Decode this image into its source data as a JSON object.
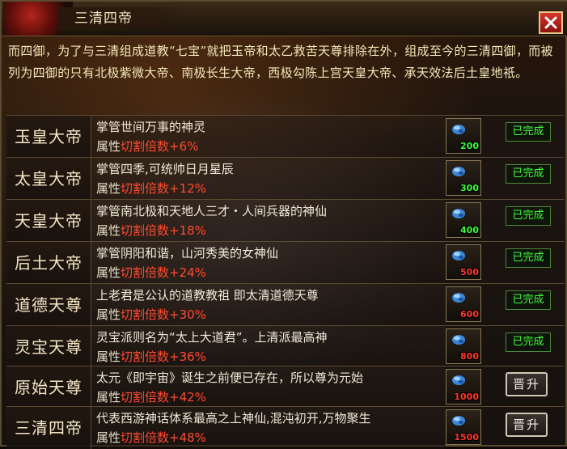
{
  "window": {
    "title": "三清四帝"
  },
  "description": "而四御，为了与三清组成道教“七宝”就把玉帝和太乙救苦天尊排除在外，组成至今的三清四御，而被列为四御的只有北极紫微大帝、南极长生大帝，西极勾陈上宫天皇大帝、承天效法后土皇地祇。",
  "attr_label": "属性",
  "attr_key": "切割倍数",
  "rows": [
    {
      "name": "玉皇大帝",
      "desc": "掌管世间万事的神灵",
      "value": "+6%",
      "qty": "200",
      "qty_color": "green",
      "status": "已完成"
    },
    {
      "name": "太皇大帝",
      "desc": "掌管四季,可统帅日月星辰",
      "value": "+12%",
      "qty": "300",
      "qty_color": "green",
      "status": "已完成"
    },
    {
      "name": "天皇大帝",
      "desc": "掌管南北极和天地人三才・人间兵器的神仙",
      "value": "+18%",
      "qty": "400",
      "qty_color": "green",
      "status": "已完成"
    },
    {
      "name": "后土大帝",
      "desc": "掌管阴阳和谐，山河秀美的女神仙",
      "value": "+24%",
      "qty": "500",
      "qty_color": "red",
      "status": "已完成"
    },
    {
      "name": "道德天尊",
      "desc": "上老君是公认的道教教祖 即太清道德天尊",
      "value": "+30%",
      "qty": "600",
      "qty_color": "red",
      "status": "已完成"
    },
    {
      "name": "灵宝天尊",
      "desc": "灵宝派则名为“太上大道君”。上清派最高神",
      "value": "+36%",
      "qty": "800",
      "qty_color": "red",
      "status": "已完成"
    },
    {
      "name": "原始天尊",
      "desc": "太元《即宇宙》诞生之前便已存在，所以尊为元始",
      "value": "+42%",
      "qty": "1000",
      "qty_color": "red",
      "button": "晋升"
    },
    {
      "name": "三清四帝",
      "desc": "代表西游神话体系最高之上神仙,混沌初开,万物聚生",
      "value": "+48%",
      "qty": "1500",
      "qty_color": "red",
      "button": "晋升"
    }
  ],
  "icons": {
    "close": "close-icon",
    "gem": "blue-gem-icon"
  },
  "colors": {
    "attr_value": "#ff4a2f",
    "done": "#3cff3c",
    "qty_green": "#3cff3c",
    "qty_red": "#ff3a2a"
  }
}
